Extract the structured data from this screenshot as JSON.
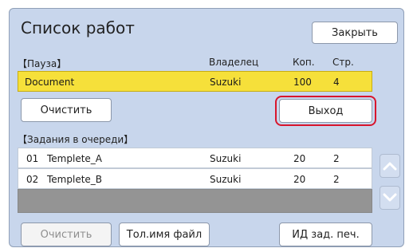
{
  "window": {
    "title": "Список работ",
    "close_label": "Закрыть"
  },
  "paused": {
    "section_label": "【Пауза】",
    "col_owner": "Владелец",
    "col_copies": "Коп.",
    "col_pages": "Стр.",
    "job": {
      "name": "Document",
      "owner": "Suzuki",
      "copies": "100",
      "pages": "4"
    }
  },
  "actions": {
    "clear_label": "Очистить",
    "exit_label": "Выход"
  },
  "queue": {
    "section_label": "【Задания в очереди】",
    "jobs": [
      {
        "num": "01",
        "name": "Templete_A",
        "owner": "Suzuki",
        "copies": "20",
        "pages": "2"
      },
      {
        "num": "02",
        "name": "Templete_B",
        "owner": "Suzuki",
        "copies": "20",
        "pages": "2"
      }
    ]
  },
  "footer": {
    "clear_label": "Очистить",
    "filename_label": "Тол.имя файл",
    "job_id_label": "ИД зад. печ."
  },
  "colors": {
    "accent_highlight": "#d8152c",
    "paused_row": "#f6e03a",
    "panel": "#c8d6ec"
  },
  "icons": {
    "up": "chevron-up-icon",
    "down": "chevron-down-icon"
  }
}
